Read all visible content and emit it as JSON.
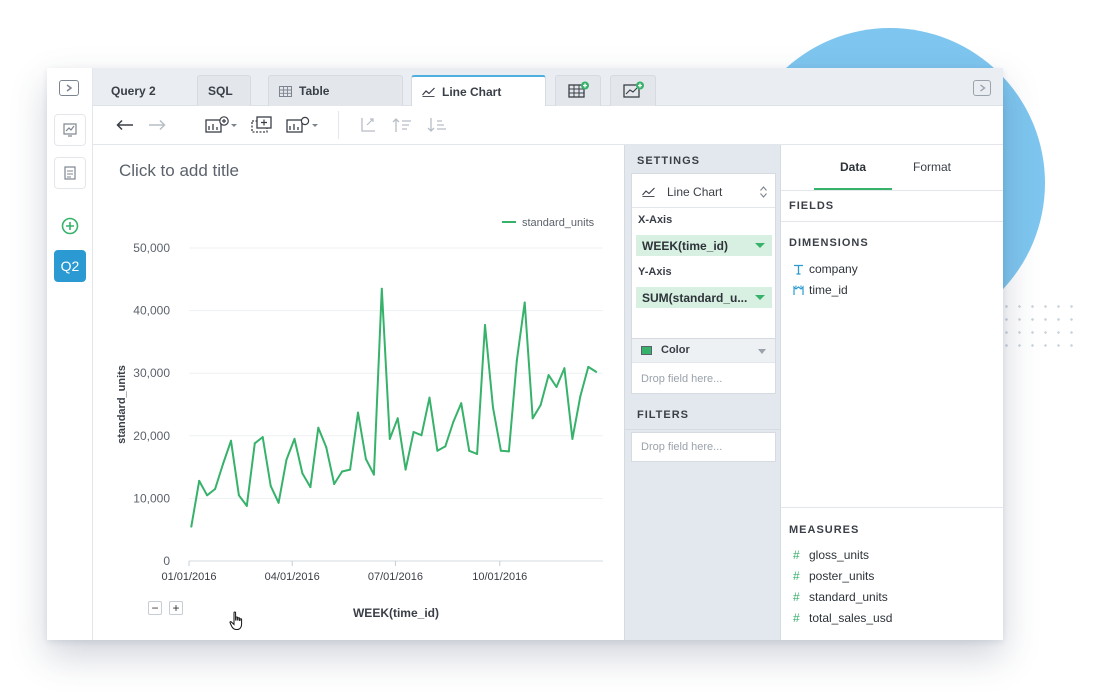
{
  "tabs": {
    "query": "Query 2",
    "sql": "SQL",
    "table": "Table",
    "line_chart": "Line Chart"
  },
  "rail": {
    "query_badge": "Q2"
  },
  "chart": {
    "title_placeholder": "Click to add title",
    "legend": "standard_units",
    "xlabel": "WEEK(time_id)",
    "ylabel": "standard_units",
    "y_ticks": [
      "50,000",
      "40,000",
      "30,000",
      "20,000",
      "10,000",
      "0"
    ],
    "x_ticks": [
      "01/01/2016",
      "04/01/2016",
      "07/01/2016",
      "10/01/2016"
    ],
    "zoom_out": "−",
    "zoom_in": "+"
  },
  "chart_data": {
    "type": "line",
    "xlabel": "WEEK(time_id)",
    "ylabel": "standard_units",
    "ylim": [
      0,
      50000
    ],
    "x_ticks": [
      "01/01/2016",
      "04/01/2016",
      "07/01/2016",
      "10/01/2016"
    ],
    "grid": true,
    "legend_position": "top-right",
    "series": [
      {
        "name": "standard_units",
        "color": "#37b26b",
        "x": [
          "2016-01-03",
          "2016-01-10",
          "2016-01-17",
          "2016-01-24",
          "2016-01-31",
          "2016-02-07",
          "2016-02-14",
          "2016-02-21",
          "2016-02-28",
          "2016-03-06",
          "2016-03-13",
          "2016-03-20",
          "2016-03-27",
          "2016-04-03",
          "2016-04-10",
          "2016-04-17",
          "2016-04-24",
          "2016-05-01",
          "2016-05-08",
          "2016-05-15",
          "2016-05-22",
          "2016-05-29",
          "2016-06-05",
          "2016-06-12",
          "2016-06-19",
          "2016-06-26",
          "2016-07-03",
          "2016-07-10",
          "2016-07-17",
          "2016-07-24",
          "2016-07-31",
          "2016-08-07",
          "2016-08-14",
          "2016-08-21",
          "2016-08-28",
          "2016-09-04",
          "2016-09-11",
          "2016-09-18",
          "2016-09-25",
          "2016-10-02",
          "2016-10-09",
          "2016-10-16",
          "2016-10-23",
          "2016-10-30",
          "2016-11-06",
          "2016-11-13",
          "2016-11-20",
          "2016-11-27",
          "2016-12-04",
          "2016-12-11",
          "2016-12-18",
          "2016-12-25"
        ],
        "values": [
          5500,
          12800,
          10500,
          11500,
          15500,
          19200,
          10500,
          8800,
          18800,
          19800,
          12000,
          9300,
          16200,
          19500,
          14000,
          11800,
          21300,
          18200,
          12300,
          14300,
          14600,
          23700,
          16300,
          13800,
          43500,
          19500,
          22800,
          14600,
          20600,
          20100,
          26100,
          17600,
          18300,
          22200,
          25200,
          17600,
          17100,
          37700,
          24500,
          17600,
          17500,
          32000,
          41300,
          22800,
          24900,
          29700,
          27800,
          30800,
          19500,
          26300,
          31000,
          30200
        ]
      }
    ]
  },
  "settings": {
    "header": "SETTINGS",
    "chart_type": "Line Chart",
    "x_axis_label": "X-Axis",
    "x_field": "WEEK(time_id)",
    "y_axis_label": "Y-Axis",
    "y_field": "SUM(standard_u...",
    "color_label": "Color",
    "color_drop": "Drop field here...",
    "filters_header": "FILTERS",
    "filters_drop": "Drop field here..."
  },
  "datapanel": {
    "tab_data": "Data",
    "tab_format": "Format",
    "fields_header": "FIELDS",
    "dimensions_header": "DIMENSIONS",
    "dimensions": [
      {
        "name": "company",
        "icon": "text-type-icon"
      },
      {
        "name": "time_id",
        "icon": "calendar-icon"
      }
    ],
    "measures_header": "MEASURES",
    "measures": [
      {
        "name": "gloss_units",
        "icon": "hash-icon"
      },
      {
        "name": "poster_units",
        "icon": "hash-icon"
      },
      {
        "name": "standard_units",
        "icon": "hash-icon"
      },
      {
        "name": "total_sales_usd",
        "icon": "hash-icon"
      }
    ]
  },
  "colors": {
    "accent_green": "#37b26b",
    "accent_blue": "#2b9ad3",
    "pill_bg": "#d8f0e1"
  }
}
